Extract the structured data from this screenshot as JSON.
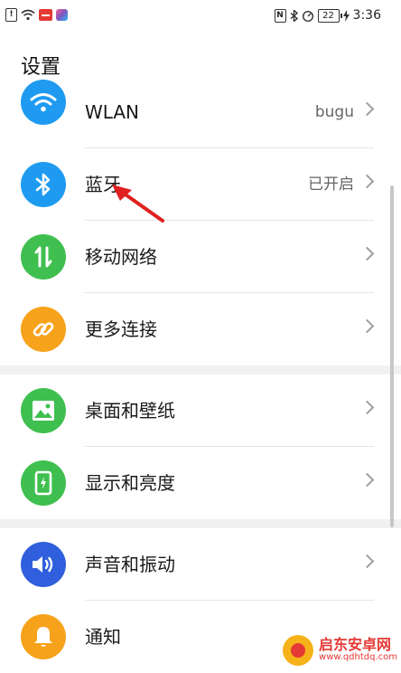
{
  "status_bar": {
    "battery": "22",
    "time": "3:36"
  },
  "page": {
    "title": "设置"
  },
  "settings": [
    {
      "label": "WLAN",
      "value": "bugu",
      "icon": "wifi-icon",
      "color": "#1e9bf0"
    },
    {
      "label": "蓝牙",
      "value": "已开启",
      "icon": "bluetooth-icon",
      "color": "#1e9bf0"
    },
    {
      "label": "移动网络",
      "value": "",
      "icon": "mobile-data-icon",
      "color": "#3fbf4f"
    },
    {
      "label": "更多连接",
      "value": "",
      "icon": "link-icon",
      "color": "#f7a21b"
    },
    {
      "label": "桌面和壁纸",
      "value": "",
      "icon": "wallpaper-icon",
      "color": "#3fbf4f"
    },
    {
      "label": "显示和亮度",
      "value": "",
      "icon": "display-icon",
      "color": "#3fbf4f"
    },
    {
      "label": "声音和振动",
      "value": "",
      "icon": "sound-icon",
      "color": "#2f5fdc"
    },
    {
      "label": "通知",
      "value": "",
      "icon": "notification-icon",
      "color": "#f7a21b"
    }
  ],
  "watermark": {
    "name": "启东安卓网",
    "url": "www.qdhtdq.com"
  }
}
